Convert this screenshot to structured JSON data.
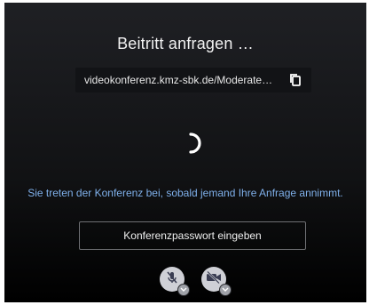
{
  "dialog": {
    "title": "Beitritt anfragen …",
    "url": "videokonferenz.kmz-sbk.de/Moderate…",
    "message": "Sie treten der Konferenz bei, sobald jemand Ihre Anfrage annimmt.",
    "password_button_label": "Konferenzpasswort eingeben"
  },
  "icons": {
    "copy": "copy-icon",
    "spinner": "loading-spinner",
    "mic": "microphone-muted-icon",
    "camera": "camera-off-icon",
    "options": "chevron-down-icon"
  },
  "colors": {
    "message_text": "#7fb0ea",
    "media_button": "#cfd0d6",
    "media_icon": "#3a3d52"
  }
}
